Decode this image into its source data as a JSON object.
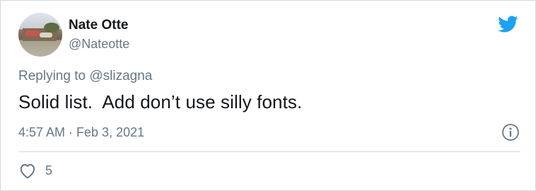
{
  "tweet": {
    "author_name": "Nate Otte",
    "author_handle": "@Nateotte",
    "replying_prefix": "Replying to ",
    "replying_to": "@slizagna",
    "text": "Solid list.  Add don’t use silly fonts.",
    "timestamp": "4:57 AM · Feb 3, 2021",
    "like_count": "5"
  },
  "icons": {
    "brand": "twitter-bird-icon",
    "info": "info-icon",
    "like": "heart-icon"
  },
  "colors": {
    "brand": "#1da1f2",
    "text": "#14171a",
    "secondary": "#657786",
    "border": "#cfd9de"
  }
}
